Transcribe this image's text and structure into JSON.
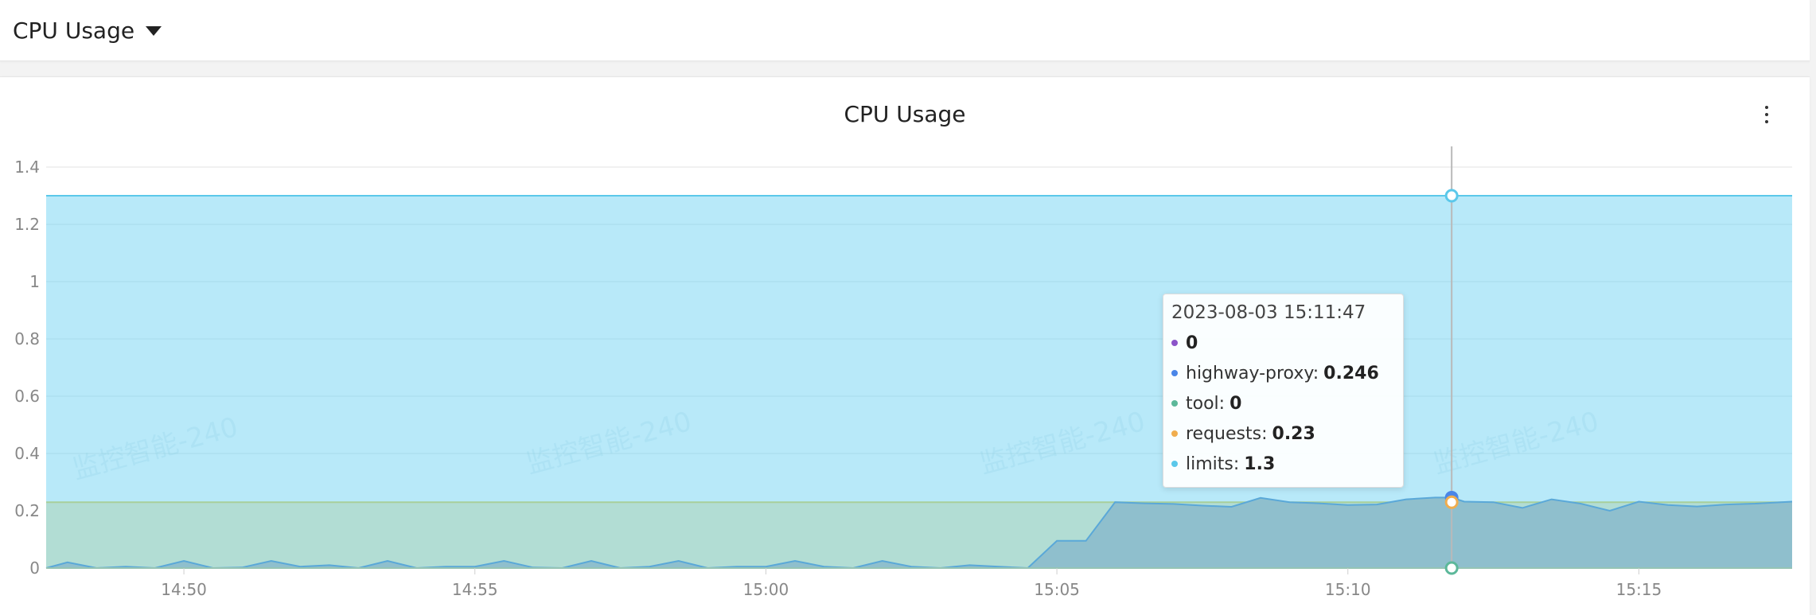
{
  "header": {
    "panel_selector_label": "CPU Usage"
  },
  "panel": {
    "title": "CPU Usage"
  },
  "watermark": "监控智能-240",
  "colors": {
    "highway_proxy": "#4a86e8",
    "series_0": "#8b54c9",
    "tool": "#5cb89a",
    "requests": "#f0ad4e",
    "limits": "#5bc8ea",
    "limits_fill": "#b8e9f9",
    "requests_fill": "#b2ddd4",
    "usage_fill": "#8fbfcd"
  },
  "tooltip": {
    "time": "2023-08-03 15:11:47",
    "rows": [
      {
        "label": "",
        "value": "0",
        "color": "#8b54c9"
      },
      {
        "label": "highway-proxy:",
        "value": "0.246",
        "color": "#4a86e8"
      },
      {
        "label": "tool:",
        "value": "0",
        "color": "#5cb89a"
      },
      {
        "label": "requests:",
        "value": "0.23",
        "color": "#f0ad4e"
      },
      {
        "label": "limits:",
        "value": "1.3",
        "color": "#5bc8ea"
      }
    ]
  },
  "chart_data": {
    "type": "area",
    "title": "CPU Usage",
    "xlabel": "",
    "ylabel": "",
    "ylim": [
      0,
      1.4
    ],
    "xlim": [
      "14:47:38",
      "15:17:38"
    ],
    "grid": true,
    "legend": "none",
    "x_ticks": [
      "14:50",
      "14:55",
      "15:00",
      "15:05",
      "15:10",
      "15:15"
    ],
    "y_ticks": [
      "0",
      "0.2",
      "0.4",
      "0.6",
      "0.8",
      "1",
      "1.2",
      "1.4"
    ],
    "cursor_time": "15:11:47",
    "series": [
      {
        "name": "limits",
        "x": [
          "14:47:38",
          "15:17:38"
        ],
        "values": [
          1.3,
          1.3
        ]
      },
      {
        "name": "requests",
        "x": [
          "14:47:38",
          "15:17:38"
        ],
        "values": [
          0.23,
          0.23
        ]
      },
      {
        "name": "highway-proxy",
        "x": [
          "14:47:38",
          "14:48:00",
          "14:48:30",
          "14:49:00",
          "14:49:30",
          "14:50:00",
          "14:50:30",
          "14:51:00",
          "14:51:30",
          "14:52:00",
          "14:52:30",
          "14:53:00",
          "14:53:30",
          "14:54:00",
          "14:54:30",
          "14:55:00",
          "14:55:30",
          "14:56:00",
          "14:56:30",
          "14:57:00",
          "14:57:30",
          "14:58:00",
          "14:58:30",
          "14:59:00",
          "14:59:30",
          "15:00:00",
          "15:00:30",
          "15:01:00",
          "15:01:30",
          "15:02:00",
          "15:02:30",
          "15:03:00",
          "15:03:30",
          "15:04:00",
          "15:04:30",
          "15:05:00",
          "15:05:30",
          "15:06:00",
          "15:06:30",
          "15:07:00",
          "15:07:30",
          "15:08:00",
          "15:08:30",
          "15:09:00",
          "15:09:30",
          "15:10:00",
          "15:10:30",
          "15:11:00",
          "15:11:30",
          "15:11:47",
          "15:12:00",
          "15:12:30",
          "15:13:00",
          "15:13:30",
          "15:14:00",
          "15:14:30",
          "15:15:00",
          "15:15:30",
          "15:16:00",
          "15:16:30",
          "15:17:00",
          "15:17:38"
        ],
        "values": [
          0,
          0.02,
          0,
          0.005,
          0,
          0.025,
          0,
          0.002,
          0.025,
          0.005,
          0.01,
          0,
          0.025,
          0,
          0.005,
          0.005,
          0.025,
          0.002,
          0,
          0.025,
          0,
          0.005,
          0.025,
          0,
          0.005,
          0.005,
          0.025,
          0.005,
          0,
          0.025,
          0.005,
          0,
          0.01,
          0.005,
          0,
          0.095,
          0.095,
          0.23,
          0.226,
          0.224,
          0.218,
          0.214,
          0.245,
          0.23,
          0.226,
          0.22,
          0.222,
          0.24,
          0.246,
          0.246,
          0.232,
          0.23,
          0.21,
          0.24,
          0.225,
          0.2,
          0.232,
          0.22,
          0.215,
          0.222,
          0.225,
          0.232
        ]
      },
      {
        "name": "tool",
        "x": [
          "14:47:38",
          "15:17:38"
        ],
        "values": [
          0,
          0
        ]
      },
      {
        "name": "",
        "x": [
          "14:47:38",
          "15:17:38"
        ],
        "values": [
          0,
          0
        ]
      }
    ]
  }
}
